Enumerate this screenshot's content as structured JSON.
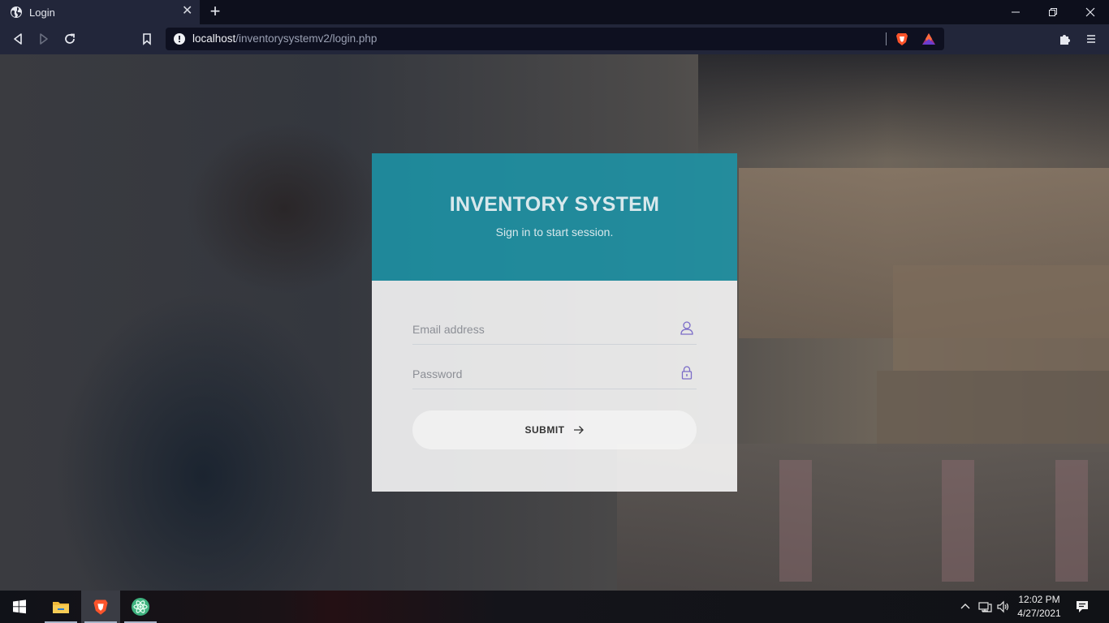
{
  "browser": {
    "tab": {
      "title": "Login"
    },
    "url": {
      "host": "localhost",
      "path": "/inventorysystemv2/login.php"
    }
  },
  "login": {
    "title": "INVENTORY SYSTEM",
    "subtitle": "Sign in to start session.",
    "email_placeholder": "Email address",
    "password_placeholder": "Password",
    "submit_label": "SUBMIT",
    "header_color": "#1b96aa"
  },
  "taskbar": {
    "time": "12:02 PM",
    "date": "4/27/2021"
  },
  "icons": [
    "globe-icon",
    "close-icon",
    "plus-icon",
    "back-icon",
    "forward-icon",
    "reload-icon",
    "bookmark-icon",
    "info-icon",
    "brave-shield-icon",
    "brave-rewards-icon",
    "extensions-icon",
    "menu-icon",
    "user-icon",
    "lock-icon",
    "arrow-right-icon",
    "windows-start-icon",
    "file-explorer-icon",
    "brave-browser-icon",
    "atom-icon",
    "chevron-up-icon",
    "network-icon",
    "volume-icon",
    "notification-icon"
  ]
}
